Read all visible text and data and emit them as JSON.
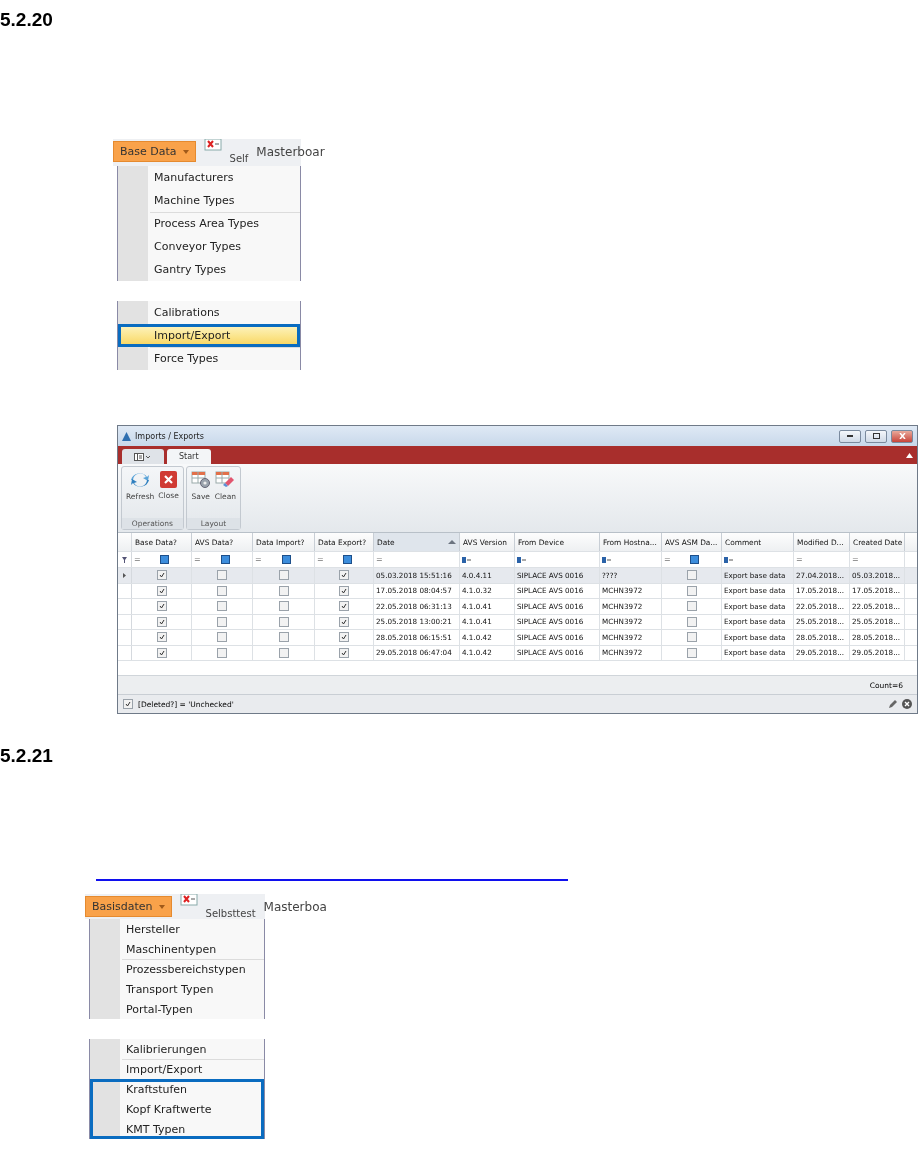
{
  "sections": [
    {
      "heading": "5.2.20",
      "menu": {
        "button": "Base Data",
        "toolbar": [
          "Self",
          "Masterboar"
        ],
        "items": [
          {
            "kind": "item",
            "label": "Manufacturers",
            "divider_above": false,
            "highlighted": false,
            "outlined": false
          },
          {
            "kind": "item",
            "label": "Machine Types",
            "divider_above": false,
            "highlighted": false,
            "outlined": false
          },
          {
            "kind": "item",
            "label": "Process Area Types",
            "divider_above": true,
            "highlighted": false,
            "outlined": false
          },
          {
            "kind": "item",
            "label": "Conveyor Types",
            "divider_above": false,
            "highlighted": false,
            "outlined": false
          },
          {
            "kind": "item",
            "label": "Gantry Types",
            "divider_above": false,
            "highlighted": false,
            "outlined": false
          },
          {
            "kind": "gap"
          },
          {
            "kind": "item",
            "label": "Calibrations",
            "divider_above": false,
            "highlighted": false,
            "outlined": false
          },
          {
            "kind": "item",
            "label": "Import/Export",
            "divider_above": false,
            "highlighted": true,
            "outlined": true
          },
          {
            "kind": "item",
            "label": "Force Types",
            "divider_above": true,
            "highlighted": false,
            "outlined": false
          }
        ]
      },
      "window": {
        "title": "Imports / Exports",
        "tabs": [
          {
            "kind": "quick",
            "selected": false
          },
          {
            "kind": "text",
            "label": "Start",
            "selected": true
          }
        ],
        "ribbon": [
          {
            "name": "Operations",
            "buttons": [
              {
                "kind": "refresh",
                "label": "Refresh"
              },
              {
                "kind": "close",
                "label": "Close"
              }
            ]
          },
          {
            "name": "Layout",
            "buttons": [
              {
                "kind": "save",
                "label": "Save"
              },
              {
                "kind": "clean",
                "label": "Clean"
              }
            ]
          }
        ],
        "columns": [
          {
            "label": "Base Data?",
            "kind": "check",
            "filter": {
              "kind": "box",
              "symbol": "=",
              "indeterminate": true
            },
            "sorted": false
          },
          {
            "label": "AVS Data?",
            "kind": "check",
            "filter": {
              "kind": "box",
              "symbol": "=",
              "indeterminate": true
            },
            "sorted": false
          },
          {
            "label": "Data Import?",
            "kind": "check",
            "filter": {
              "kind": "box",
              "symbol": "=",
              "indeterminate": true
            },
            "sorted": false
          },
          {
            "label": "Data Export?",
            "kind": "check",
            "filter": {
              "kind": "box",
              "symbol": "=",
              "indeterminate": true
            },
            "sorted": false
          },
          {
            "label": "Date",
            "kind": "text",
            "filter": {
              "kind": "equals",
              "symbol": "="
            },
            "sorted": true
          },
          {
            "label": "AVS Version",
            "kind": "text",
            "filter": {
              "kind": "text"
            },
            "sorted": false
          },
          {
            "label": "From Device",
            "kind": "text",
            "filter": {
              "kind": "text"
            },
            "sorted": false
          },
          {
            "label": "From Hostna...",
            "kind": "text",
            "filter": {
              "kind": "text"
            },
            "sorted": false
          },
          {
            "label": "AVS ASM Da...",
            "kind": "check",
            "filter": {
              "kind": "box",
              "symbol": "=",
              "indeterminate": true
            },
            "sorted": false
          },
          {
            "label": "Comment",
            "kind": "text",
            "filter": {
              "kind": "text"
            },
            "sorted": false
          },
          {
            "label": "Modified D...",
            "kind": "text",
            "filter": {
              "kind": "equals",
              "symbol": "="
            },
            "sorted": false
          },
          {
            "label": "Created Date",
            "kind": "text",
            "filter": {
              "kind": "equals",
              "symbol": "="
            },
            "sorted": false
          }
        ],
        "rows": [
          {
            "selected": true,
            "cells": [
              true,
              false,
              false,
              true,
              "05.03.2018 15:51:16",
              "4.0.4.11",
              "SIPLACE AVS 0016",
              "????",
              false,
              "Export base data",
              "27.04.2018...",
              "05.03.2018..."
            ]
          },
          {
            "selected": false,
            "cells": [
              true,
              false,
              false,
              true,
              "17.05.2018 08:04:57",
              "4.1.0.32",
              "SIPLACE AVS 0016",
              "MCHN3972",
              false,
              "Export base data",
              "17.05.2018...",
              "17.05.2018..."
            ]
          },
          {
            "selected": false,
            "cells": [
              true,
              false,
              false,
              true,
              "22.05.2018 06:31:13",
              "4.1.0.41",
              "SIPLACE AVS 0016",
              "MCHN3972",
              false,
              "Export base data",
              "22.05.2018...",
              "22.05.2018..."
            ]
          },
          {
            "selected": false,
            "cells": [
              true,
              false,
              false,
              true,
              "25.05.2018 13:00:21",
              "4.1.0.41",
              "SIPLACE AVS 0016",
              "MCHN3972",
              false,
              "Export base data",
              "25.05.2018...",
              "25.05.2018..."
            ]
          },
          {
            "selected": false,
            "cells": [
              true,
              false,
              false,
              true,
              "28.05.2018 06:15:51",
              "4.1.0.42",
              "SIPLACE AVS 0016",
              "MCHN3972",
              false,
              "Export base data",
              "28.05.2018...",
              "28.05.2018..."
            ]
          },
          {
            "selected": false,
            "cells": [
              true,
              false,
              false,
              true,
              "29.05.2018 06:47:04",
              "4.1.0.42",
              "SIPLACE AVS 0016",
              "MCHN3972",
              false,
              "Export base data",
              "29.05.2018...",
              "29.05.2018..."
            ]
          }
        ],
        "count": "Count=6",
        "filter": {
          "checked": true,
          "text": "[Deleted?] = 'Unchecked'"
        }
      }
    },
    {
      "heading": "5.2.21",
      "link_underline": true,
      "menu": {
        "button": "Basisdaten",
        "toolbar": [
          "Selbsttest",
          "Masterboa"
        ],
        "items": [
          {
            "kind": "item",
            "label": "Hersteller",
            "divider_above": false,
            "highlighted": false,
            "outlined": false
          },
          {
            "kind": "item",
            "label": "Maschinentypen",
            "divider_above": false,
            "highlighted": false,
            "outlined": false
          },
          {
            "kind": "item",
            "label": "Prozessbereichstypen",
            "divider_above": true,
            "highlighted": false,
            "outlined": false
          },
          {
            "kind": "item",
            "label": "Transport Typen",
            "divider_above": false,
            "highlighted": false,
            "outlined": false
          },
          {
            "kind": "item",
            "label": "Portal-Typen",
            "divider_above": false,
            "highlighted": false,
            "outlined": false
          },
          {
            "kind": "gap"
          },
          {
            "kind": "item",
            "label": "Kalibrierungen",
            "divider_above": false,
            "highlighted": false,
            "outlined": false
          },
          {
            "kind": "item",
            "label": "Import/Export",
            "divider_above": true,
            "highlighted": false,
            "outlined": false
          },
          {
            "kind": "item",
            "label": "Kraftstufen",
            "divider_above": true,
            "highlighted": false,
            "outlined": true
          },
          {
            "kind": "item",
            "label": "Kopf Kraftwerte",
            "divider_above": false,
            "highlighted": false,
            "outlined": true
          },
          {
            "kind": "item",
            "label": "KMT Typen",
            "divider_above": false,
            "highlighted": false,
            "outlined": true
          }
        ]
      }
    }
  ]
}
